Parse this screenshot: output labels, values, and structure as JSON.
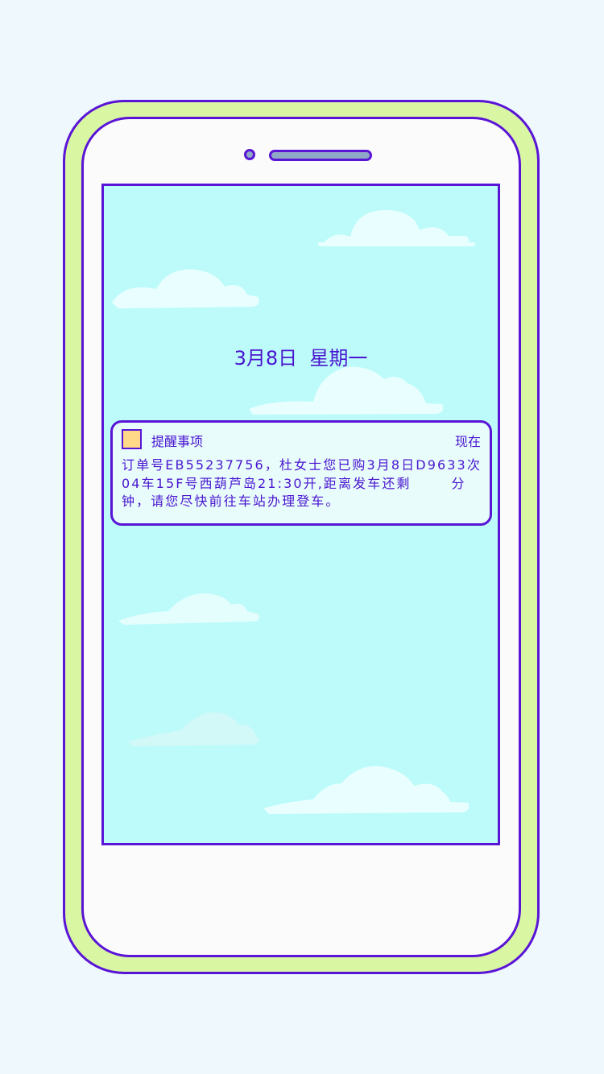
{
  "lock_screen": {
    "date": "3月8日",
    "weekday": "星期一"
  },
  "notification": {
    "app_name": "提醒事项",
    "time": "现在",
    "message_part1": "订单号EB55237756，杜女士您已购3月8日D9633次04车15F号西葫芦岛21:30开,距离发车还剩",
    "message_part2": "分钟，请您尽快前往车站办理登车。"
  },
  "colors": {
    "background": "#eef8fd",
    "phone_shell": "#d9f7a3",
    "phone_outline": "#5a14d6",
    "screen": "#bcfbfa",
    "text": "#4a14d0",
    "notification_icon": "#ffd987"
  }
}
